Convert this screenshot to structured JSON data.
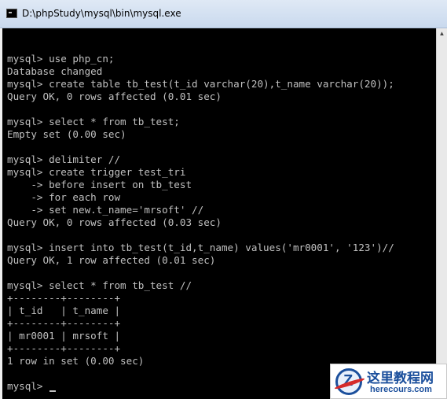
{
  "window": {
    "title": "D:\\phpStudy\\mysql\\bin\\mysql.exe"
  },
  "console": {
    "lines": [
      "",
      "mysql> use php_cn;",
      "Database changed",
      "mysql> create table tb_test(t_id varchar(20),t_name varchar(20));",
      "Query OK, 0 rows affected (0.01 sec)",
      "",
      "mysql> select * from tb_test;",
      "Empty set (0.00 sec)",
      "",
      "mysql> delimiter //",
      "mysql> create trigger test_tri",
      "    -> before insert on tb_test",
      "    -> for each row",
      "    -> set new.t_name='mrsoft' //",
      "Query OK, 0 rows affected (0.03 sec)",
      "",
      "mysql> insert into tb_test(t_id,t_name) values('mr0001', '123')//",
      "Query OK, 1 row affected (0.01 sec)",
      "",
      "mysql> select * from tb_test //",
      "+--------+--------+",
      "| t_id   | t_name |",
      "+--------+--------+",
      "| mr0001 | mrsoft |",
      "+--------+--------+",
      "1 row in set (0.00 sec)",
      "",
      "mysql> "
    ]
  },
  "watermark": {
    "name": "这里教程网",
    "url": "herecours.com"
  }
}
